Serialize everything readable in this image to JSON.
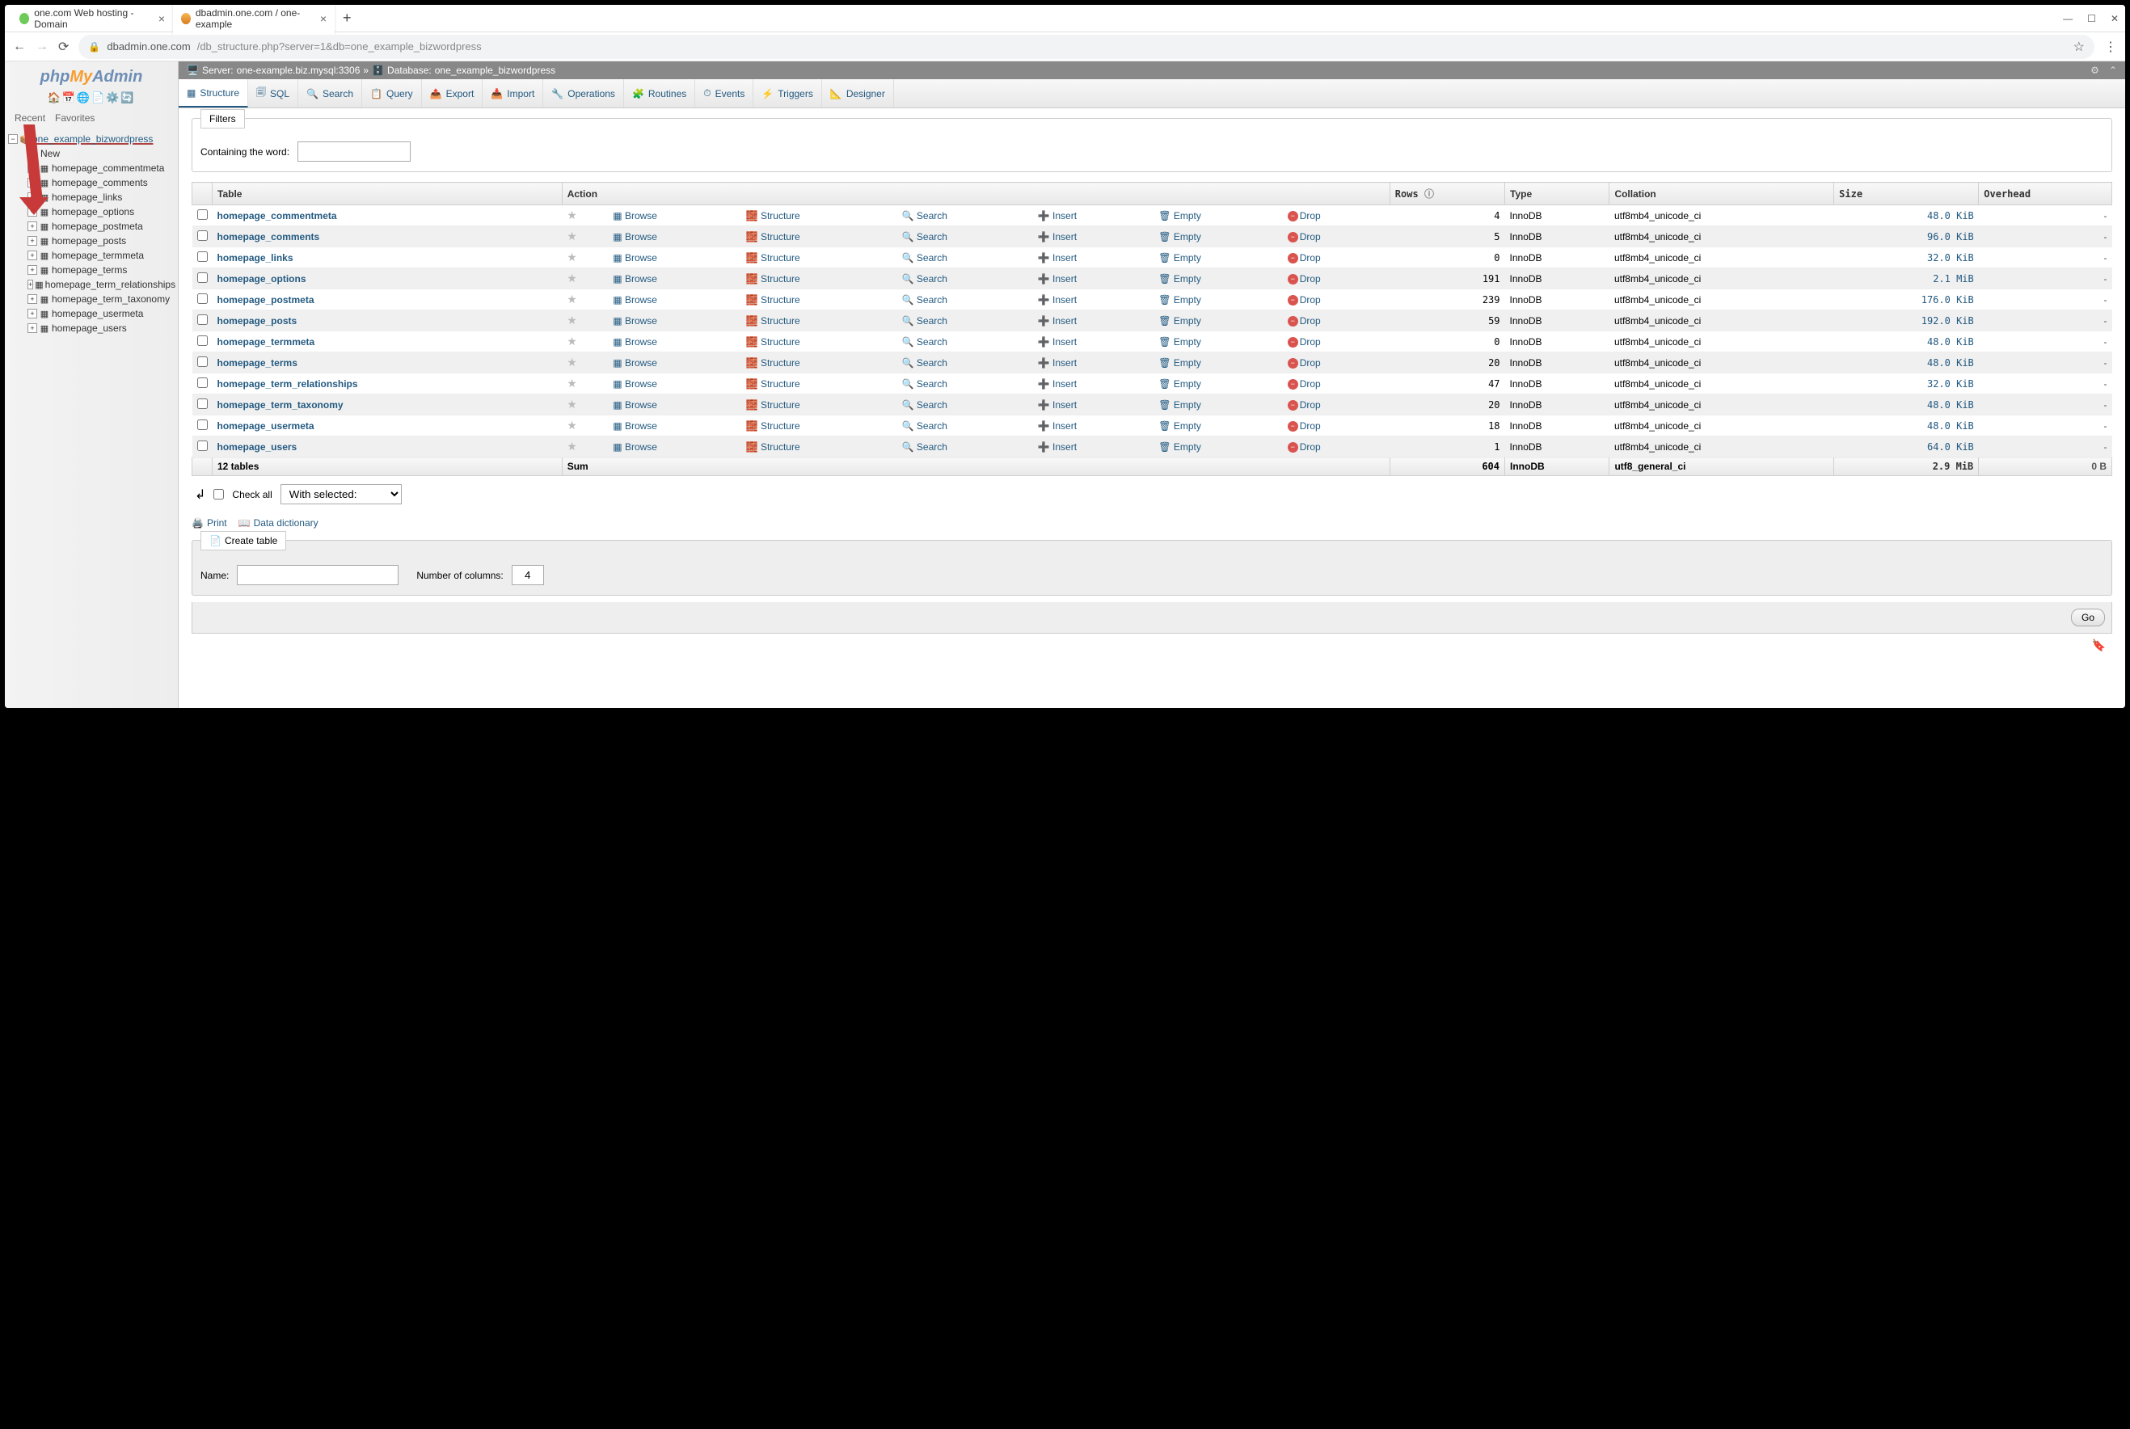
{
  "browser": {
    "tabs": [
      {
        "title": "one.com Web hosting  -  Domain",
        "active": false
      },
      {
        "title": "dbadmin.one.com / one-example",
        "active": true
      }
    ],
    "url_host": "dbadmin.one.com",
    "url_path": "/db_structure.php?server=1&db=one_example_bizwordpress"
  },
  "sidebar": {
    "logo": {
      "p1": "php",
      "p2": "My",
      "p3": "Admin"
    },
    "tabs": {
      "recent": "Recent",
      "favorites": "Favorites"
    },
    "db_name": "one_example_bizwordpress",
    "new_label": "New",
    "tables": [
      "homepage_commentmeta",
      "homepage_comments",
      "homepage_links",
      "homepage_options",
      "homepage_postmeta",
      "homepage_posts",
      "homepage_termmeta",
      "homepage_terms",
      "homepage_term_relationships",
      "homepage_term_taxonomy",
      "homepage_usermeta",
      "homepage_users"
    ]
  },
  "breadcrumb": {
    "server_label": "Server:",
    "server_value": "one-example.biz.mysql:3306",
    "db_label": "Database:",
    "db_value": "one_example_bizwordpress"
  },
  "topnav": [
    "Structure",
    "SQL",
    "Search",
    "Query",
    "Export",
    "Import",
    "Operations",
    "Routines",
    "Events",
    "Triggers",
    "Designer"
  ],
  "filters": {
    "legend": "Filters",
    "label": "Containing the word:"
  },
  "table_headers": {
    "table": "Table",
    "action": "Action",
    "rows": "Rows",
    "type": "Type",
    "collation": "Collation",
    "size": "Size",
    "overhead": "Overhead"
  },
  "action_labels": {
    "browse": "Browse",
    "structure": "Structure",
    "search": "Search",
    "insert": "Insert",
    "empty": "Empty",
    "drop": "Drop"
  },
  "rows": [
    {
      "name": "homepage_commentmeta",
      "rows": "4",
      "type": "InnoDB",
      "coll": "utf8mb4_unicode_ci",
      "size": "48.0 KiB",
      "oh": "-"
    },
    {
      "name": "homepage_comments",
      "rows": "5",
      "type": "InnoDB",
      "coll": "utf8mb4_unicode_ci",
      "size": "96.0 KiB",
      "oh": "-"
    },
    {
      "name": "homepage_links",
      "rows": "0",
      "type": "InnoDB",
      "coll": "utf8mb4_unicode_ci",
      "size": "32.0 KiB",
      "oh": "-"
    },
    {
      "name": "homepage_options",
      "rows": "191",
      "type": "InnoDB",
      "coll": "utf8mb4_unicode_ci",
      "size": "2.1 MiB",
      "oh": "-"
    },
    {
      "name": "homepage_postmeta",
      "rows": "239",
      "type": "InnoDB",
      "coll": "utf8mb4_unicode_ci",
      "size": "176.0 KiB",
      "oh": "-"
    },
    {
      "name": "homepage_posts",
      "rows": "59",
      "type": "InnoDB",
      "coll": "utf8mb4_unicode_ci",
      "size": "192.0 KiB",
      "oh": "-"
    },
    {
      "name": "homepage_termmeta",
      "rows": "0",
      "type": "InnoDB",
      "coll": "utf8mb4_unicode_ci",
      "size": "48.0 KiB",
      "oh": "-"
    },
    {
      "name": "homepage_terms",
      "rows": "20",
      "type": "InnoDB",
      "coll": "utf8mb4_unicode_ci",
      "size": "48.0 KiB",
      "oh": "-"
    },
    {
      "name": "homepage_term_relationships",
      "rows": "47",
      "type": "InnoDB",
      "coll": "utf8mb4_unicode_ci",
      "size": "32.0 KiB",
      "oh": "-"
    },
    {
      "name": "homepage_term_taxonomy",
      "rows": "20",
      "type": "InnoDB",
      "coll": "utf8mb4_unicode_ci",
      "size": "48.0 KiB",
      "oh": "-"
    },
    {
      "name": "homepage_usermeta",
      "rows": "18",
      "type": "InnoDB",
      "coll": "utf8mb4_unicode_ci",
      "size": "48.0 KiB",
      "oh": "-"
    },
    {
      "name": "homepage_users",
      "rows": "1",
      "type": "InnoDB",
      "coll": "utf8mb4_unicode_ci",
      "size": "64.0 KiB",
      "oh": "-"
    }
  ],
  "sum": {
    "label": "12 tables",
    "action": "Sum",
    "rows": "604",
    "type": "InnoDB",
    "coll": "utf8_general_ci",
    "size": "2.9 MiB",
    "oh": "0 B"
  },
  "checkall": {
    "label": "Check all",
    "with_selected": "With selected:"
  },
  "print": {
    "print": "Print",
    "dict": "Data dictionary"
  },
  "create": {
    "legend": "Create table",
    "name_label": "Name:",
    "cols_label": "Number of columns:",
    "cols_value": "4",
    "go": "Go"
  }
}
